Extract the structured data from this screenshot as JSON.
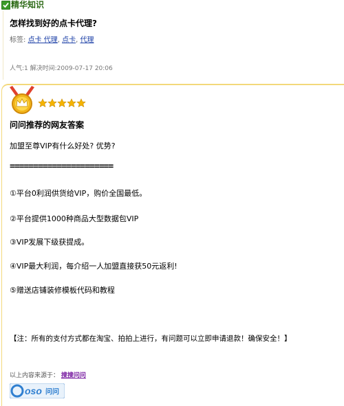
{
  "section": {
    "label": "精华知识"
  },
  "question": {
    "title": "怎样找到好的点卡代理?",
    "tags_label": "标签:",
    "tags": [
      "点卡 代理",
      "点卡",
      "代理"
    ],
    "meta": "人气:1  解决时间:2009-07-17 20:06"
  },
  "answer": {
    "heading": "问问推荐的网友答案",
    "paragraphs": [
      "加盟至尊VIP有什么好处? 优势?",
      "①平台0利润供货给VIP，购价全国最低。",
      "②平台提供1000种商品大型数据包VIP",
      "③VIP发展下级获提成。",
      "④VIP最大利润，每介绍一人加盟直接获50元返利!",
      "⑤赠送店铺装修模板代码和教程",
      "【注：所有的支付方式都在淘宝、拍拍上进行，有问题可以立即申请退款！确保安全！】"
    ],
    "divider": "======================",
    "stars": 5,
    "source_label": "以上内容来源于：",
    "source_link": "搜搜问问",
    "logo_text": "soso问问"
  },
  "colors": {
    "accent_green": "#2d6a16",
    "link_blue": "#1a3ea6",
    "link_purple": "#7a1fa2",
    "border_gold": "#f3d87a",
    "star_gold": "#f5b400"
  }
}
